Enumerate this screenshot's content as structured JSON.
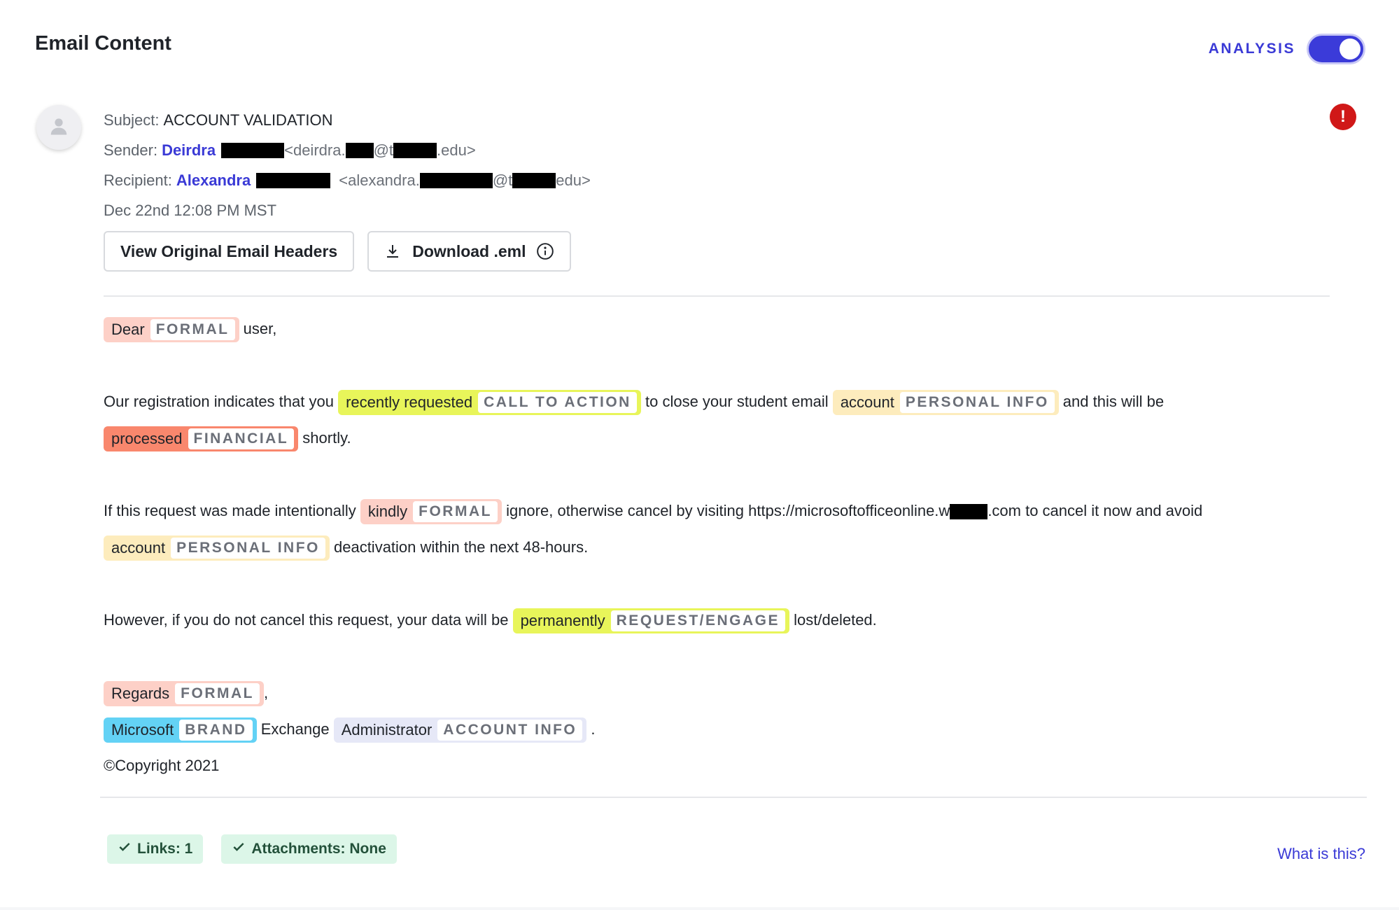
{
  "header": {
    "title": "Email Content",
    "analysis_label": "ANALYSIS",
    "analysis_on": true
  },
  "meta": {
    "subject_label": "Subject:",
    "subject": "ACCOUNT VALIDATION",
    "sender_label": "Sender:",
    "sender_name": "Deirdra",
    "sender_addr_a": "<deirdra.",
    "sender_addr_b": "@t",
    "sender_addr_c": ".edu>",
    "recipient_label": "Recipient:",
    "recipient_name": "Alexandra",
    "recipient_addr_a": "<alexandra.",
    "recipient_addr_b": "@t",
    "recipient_addr_c": "edu>",
    "date": "Dec 22nd 12:08 PM MST"
  },
  "actions": {
    "view_headers": "View Original Email Headers",
    "download": "Download .eml"
  },
  "body": {
    "p1": {
      "tag_text": "Dear",
      "tag_label": "FORMAL",
      "after": "user,"
    },
    "p2": {
      "t1": "Our registration indicates that you",
      "tag1_text": "recently requested",
      "tag1_label": "CALL TO ACTION",
      "t2": "to close your student email",
      "tag2_text": "account",
      "tag2_label": "PERSONAL INFO",
      "t3": "and this will be",
      "tag3_text": "processed",
      "tag3_label": "FINANCIAL",
      "t4": "shortly."
    },
    "p3": {
      "t1": "If this request was made intentionally",
      "tag1_text": "kindly",
      "tag1_label": "FORMAL",
      "t2": "ignore, otherwise cancel by visiting https://microsoftofficeonline.w",
      "t3": ".com to cancel it now and avoid",
      "tag2_text": "account",
      "tag2_label": "PERSONAL INFO",
      "t4": "deactivation within the next 48-hours."
    },
    "p4": {
      "t1": "However, if you do not cancel this request, your data will be",
      "tag_text": "permanently",
      "tag_label": "REQUEST/ENGAGE",
      "t2": "lost/deleted."
    },
    "sign": {
      "tag1_text": "Regards",
      "tag1_label": "FORMAL",
      "comma": ",",
      "tag2_text": "Microsoft",
      "tag2_label": "BRAND",
      "mid": "Exchange",
      "tag3_text": "Administrator",
      "tag3_label": "ACCOUNT INFO",
      "period": ".",
      "copyright": "©Copyright 2021"
    }
  },
  "footer": {
    "links": "Links: 1",
    "attachments": "Attachments: None",
    "what": "What is this?"
  },
  "colors": {
    "accent": "#3a3ad6",
    "formal": "#fdd0c7",
    "call_to_action": "#e8f55a",
    "personal_info": "#fdecbd",
    "financial": "#f9876d",
    "brand": "#63d2f5",
    "account_info": "#e6e8f7",
    "alert": "#d01818"
  },
  "icons": [
    "user-icon",
    "alert-icon",
    "download-icon",
    "info-icon",
    "check-icon"
  ]
}
